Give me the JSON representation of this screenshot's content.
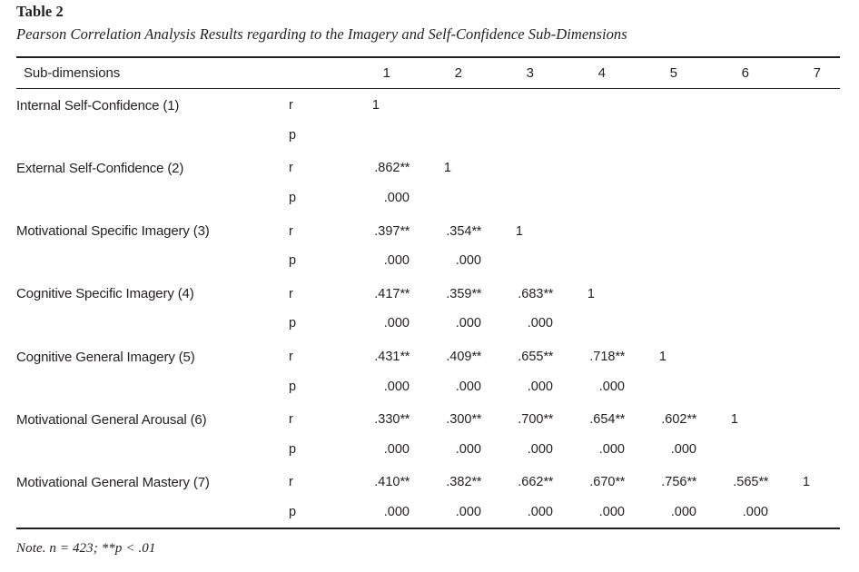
{
  "caption": {
    "table_number": "Table 2",
    "title": "Pearson Correlation Analysis Results regarding to the Imagery and Self-Confidence Sub-Dimensions"
  },
  "table": {
    "header": {
      "label": "Sub-dimensions",
      "stat": "",
      "columns": [
        "1",
        "2",
        "3",
        "4",
        "5",
        "6",
        "7"
      ]
    },
    "stat_labels": {
      "r": "r",
      "p": "p"
    },
    "rows": [
      {
        "label": "Internal Self-Confidence (1)",
        "r": [
          "1",
          "",
          "",
          "",
          "",
          "",
          ""
        ],
        "p": [
          "",
          "",
          "",
          "",
          "",
          "",
          ""
        ]
      },
      {
        "label": "External Self-Confidence (2)",
        "r": [
          ".862**",
          "1",
          "",
          "",
          "",
          "",
          ""
        ],
        "p": [
          ".000",
          "",
          "",
          "",
          "",
          "",
          ""
        ]
      },
      {
        "label": "Motivational Specific Imagery (3)",
        "r": [
          ".397**",
          ".354**",
          "1",
          "",
          "",
          "",
          ""
        ],
        "p": [
          ".000",
          ".000",
          "",
          "",
          "",
          "",
          ""
        ]
      },
      {
        "label": "Cognitive Specific Imagery (4)",
        "r": [
          ".417**",
          ".359**",
          ".683**",
          "1",
          "",
          "",
          ""
        ],
        "p": [
          ".000",
          ".000",
          ".000",
          "",
          "",
          "",
          ""
        ]
      },
      {
        "label": "Cognitive General Imagery (5)",
        "r": [
          ".431**",
          ".409**",
          ".655**",
          ".718**",
          "1",
          "",
          ""
        ],
        "p": [
          ".000",
          ".000",
          ".000",
          ".000",
          "",
          "",
          ""
        ]
      },
      {
        "label": "Motivational General Arousal (6)",
        "r": [
          ".330**",
          ".300**",
          ".700**",
          ".654**",
          ".602**",
          "1",
          ""
        ],
        "p": [
          ".000",
          ".000",
          ".000",
          ".000",
          ".000",
          "",
          ""
        ]
      },
      {
        "label": "Motivational General Mastery (7)",
        "r": [
          ".410**",
          ".382**",
          ".662**",
          ".670**",
          ".756**",
          ".565**",
          "1"
        ],
        "p": [
          ".000",
          ".000",
          ".000",
          ".000",
          ".000",
          ".000",
          ""
        ]
      }
    ]
  },
  "note": "Note. n = 423; **p < .01",
  "colors": {
    "text": "#231f20",
    "rule": "#231f20",
    "background": "#ffffff"
  }
}
